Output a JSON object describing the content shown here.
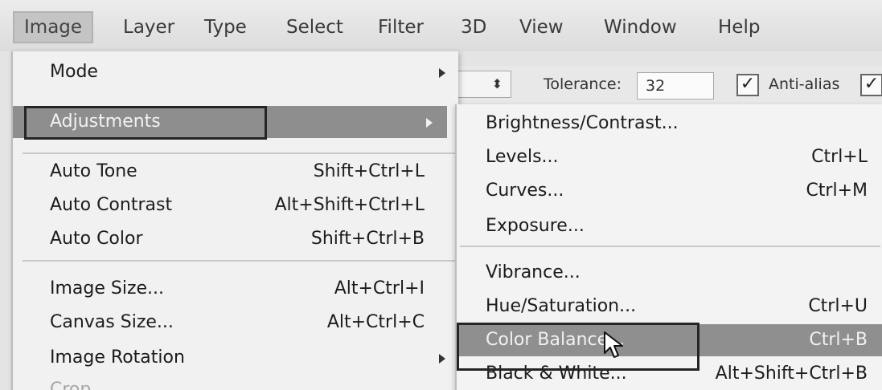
{
  "menubar": {
    "items": [
      "Image",
      "Layer",
      "Type",
      "Select",
      "Filter",
      "3D",
      "View",
      "Window",
      "Help"
    ],
    "active": "Image"
  },
  "options_bar": {
    "tolerance_label": "Tolerance:",
    "tolerance_value": "32",
    "anti_alias_label": "Anti-alias",
    "anti_alias_checked": true,
    "checkmark": "✓",
    "select_arrows": "⬍"
  },
  "image_menu": {
    "items": [
      {
        "label": "Mode",
        "shortcut": "",
        "submenu": true
      },
      {
        "label": "Adjustments",
        "shortcut": "",
        "submenu": true,
        "highlighted": true
      },
      {
        "label": "Auto Tone",
        "shortcut": "Shift+Ctrl+L"
      },
      {
        "label": "Auto Contrast",
        "shortcut": "Alt+Shift+Ctrl+L"
      },
      {
        "label": "Auto Color",
        "shortcut": "Shift+Ctrl+B"
      },
      {
        "label": "Image Size...",
        "shortcut": "Alt+Ctrl+I"
      },
      {
        "label": "Canvas Size...",
        "shortcut": "Alt+Ctrl+C"
      },
      {
        "label": "Image Rotation",
        "shortcut": "",
        "submenu": true
      },
      {
        "label": "Crop",
        "shortcut": "",
        "disabled": true
      }
    ]
  },
  "adjustments_menu": {
    "items": [
      {
        "label": "Brightness/Contrast...",
        "shortcut": ""
      },
      {
        "label": "Levels...",
        "shortcut": "Ctrl+L"
      },
      {
        "label": "Curves...",
        "shortcut": "Ctrl+M"
      },
      {
        "label": "Exposure...",
        "shortcut": ""
      },
      {
        "label": "Vibrance...",
        "shortcut": ""
      },
      {
        "label": "Hue/Saturation...",
        "shortcut": "Ctrl+U"
      },
      {
        "label": "Color Balance...",
        "shortcut": "Ctrl+B",
        "highlighted": true
      },
      {
        "label": "Black & White...",
        "shortcut": "Alt+Shift+Ctrl+B"
      }
    ]
  },
  "colors": {
    "highlight": "#8e8e8e",
    "menu_bg": "#f1f1f1",
    "frame": "#252525"
  },
  "icons": [
    "submenu-arrow-icon",
    "mouse-cursor-icon",
    "checkbox-check-icon",
    "select-arrows-icon"
  ]
}
